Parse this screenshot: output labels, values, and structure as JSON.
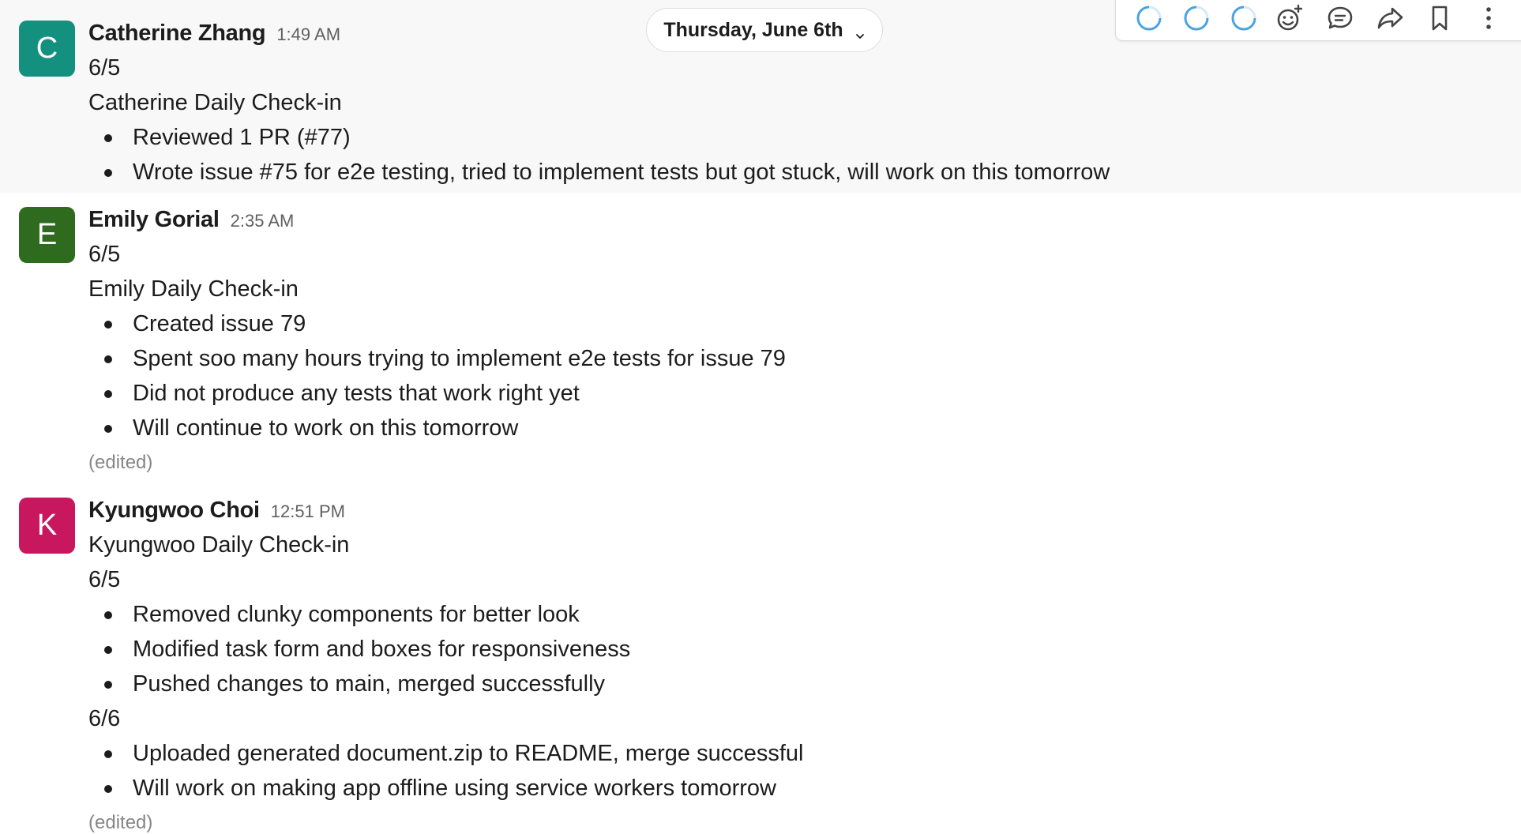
{
  "date_divider": {
    "label": "Thursday, June 6th",
    "icon": "chevron-down-icon"
  },
  "message_actions": [
    {
      "icon": "reaction-loading-icon"
    },
    {
      "icon": "reaction-loading-icon"
    },
    {
      "icon": "reaction-loading-icon"
    },
    {
      "icon": "add-reaction-icon"
    },
    {
      "icon": "reply-in-thread-icon"
    },
    {
      "icon": "forward-icon"
    },
    {
      "icon": "bookmark-icon"
    },
    {
      "icon": "more-actions-icon"
    }
  ],
  "messages": [
    {
      "author": "Catherine Zhang",
      "avatar_letter": "C",
      "avatar_color": "#14907f",
      "time": "1:49 AM",
      "lines": [
        {
          "text": "6/5"
        },
        {
          "text": "Catherine Daily Check-in"
        }
      ],
      "bullets": [
        "Reviewed 1 PR (#77)",
        "Wrote issue #75 for e2e testing, tried to implement tests but got stuck, will work on this tomorrow"
      ]
    },
    {
      "author": "Emily Gorial",
      "avatar_letter": "E",
      "avatar_color": "#2e6b1f",
      "time": "2:35 AM",
      "lines": [
        {
          "text": "6/5"
        },
        {
          "text": "Emily Daily Check-in"
        }
      ],
      "bullets": [
        "Created issue 79",
        "Spent soo many hours trying to implement e2e tests for issue 79",
        "Did not produce any tests that work right yet",
        "Will continue to work on this tomorrow"
      ],
      "edited": "(edited)"
    },
    {
      "author": "Kyungwoo Choi",
      "avatar_letter": "K",
      "avatar_color": "#c8175f",
      "time": "12:51 PM",
      "header_text": "Kyungwoo Daily Check-in",
      "sections": [
        {
          "date": "6/5",
          "bullets": [
            "Removed clunky components for better look",
            "Modified task form and boxes for responsiveness",
            "Pushed changes to main, merged successfully"
          ]
        },
        {
          "date": "6/6",
          "bullets": [
            "Uploaded generated document.zip to README, merge successful",
            "Will work on making app offline using service workers tomorrow"
          ]
        }
      ],
      "edited": "(edited)"
    }
  ]
}
